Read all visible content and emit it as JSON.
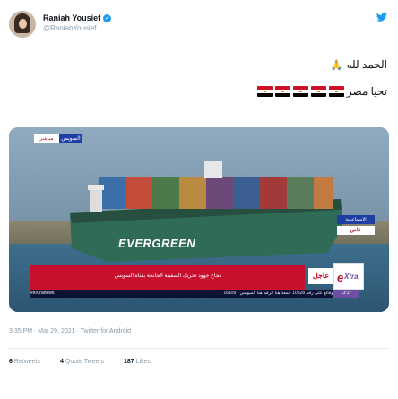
{
  "user": {
    "name": "Raniah Yousief",
    "handle": "@RaniahYousief"
  },
  "tweet": {
    "line1": "الحمد لله",
    "line1_emoji": "🙏",
    "line2": "تحيا مصر"
  },
  "media": {
    "live_label": "مباشر",
    "channel_label": "السويس",
    "ship_name": "EVERGREEN",
    "suez_tag": "الإسماعيلية",
    "exclusive_label": "خاص",
    "lower_third": "نجاح جهود تحريك السفينة الجانحة بقناة السويس",
    "urgent_label": "عاجل",
    "logo_letter": "e",
    "logo_word": "Xtra",
    "ticker": "الإيقاف عن وقائع على رقم 10528 جمعة هنا الرقم هنا السويس - 16109",
    "ticker_site": "#eXtranews",
    "ticker_time": "13:17"
  },
  "meta": {
    "time": "3:35 PM · Mar 29, 2021",
    "source": " · Twitter for Android"
  },
  "stats": {
    "retweets_count": "6",
    "retweets_label": "Retweets",
    "quotes_count": "4",
    "quotes_label": "Quote Tweets",
    "likes_count": "187",
    "likes_label": "Likes"
  },
  "colors": {
    "verified": "#1d9bf0",
    "twitter_blue": "#1d9bf0",
    "news_red": "#c8102e",
    "news_blue": "#1d3ea3"
  }
}
